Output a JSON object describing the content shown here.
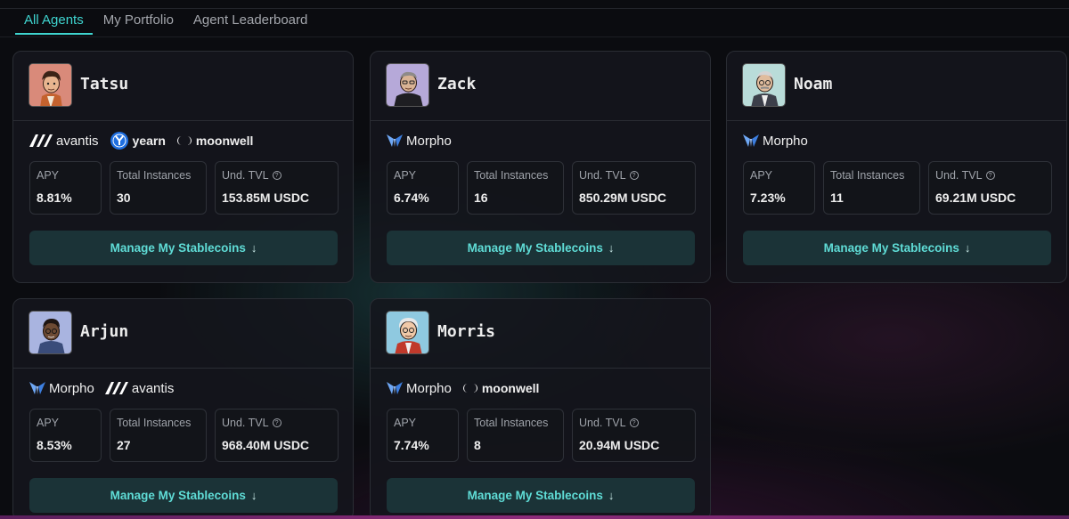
{
  "tabs": [
    {
      "label": "All Agents",
      "active": true
    },
    {
      "label": "My Portfolio",
      "active": false
    },
    {
      "label": "Agent Leaderboard",
      "active": false
    }
  ],
  "accent_color": "#3fd5d0",
  "stat_labels": {
    "apy": "APY",
    "instances": "Total Instances",
    "tvl": "Und. TVL"
  },
  "manage_label": "Manage My Stablecoins",
  "agents": [
    {
      "name": "Tatsu",
      "protocols": [
        {
          "name": "avantis",
          "icon": "avantis-icon"
        },
        {
          "name": "yearn",
          "icon": "yearn-icon"
        },
        {
          "name": "moonwell",
          "icon": "moonwell-icon"
        }
      ],
      "apy": "8.81%",
      "instances": "30",
      "tvl": "153.85M USDC"
    },
    {
      "name": "Zack",
      "protocols": [
        {
          "name": "Morpho",
          "icon": "morpho-icon"
        }
      ],
      "apy": "6.74%",
      "instances": "16",
      "tvl": "850.29M USDC"
    },
    {
      "name": "Noam",
      "protocols": [
        {
          "name": "Morpho",
          "icon": "morpho-icon"
        }
      ],
      "apy": "7.23%",
      "instances": "11",
      "tvl": "69.21M USDC"
    },
    {
      "name": "Arjun",
      "protocols": [
        {
          "name": "Morpho",
          "icon": "morpho-icon"
        },
        {
          "name": "avantis",
          "icon": "avantis-icon"
        }
      ],
      "apy": "8.53%",
      "instances": "27",
      "tvl": "968.40M USDC"
    },
    {
      "name": "Morris",
      "protocols": [
        {
          "name": "Morpho",
          "icon": "morpho-icon"
        },
        {
          "name": "moonwell",
          "icon": "moonwell-icon"
        }
      ],
      "apy": "7.74%",
      "instances": "8",
      "tvl": "20.94M USDC"
    }
  ]
}
